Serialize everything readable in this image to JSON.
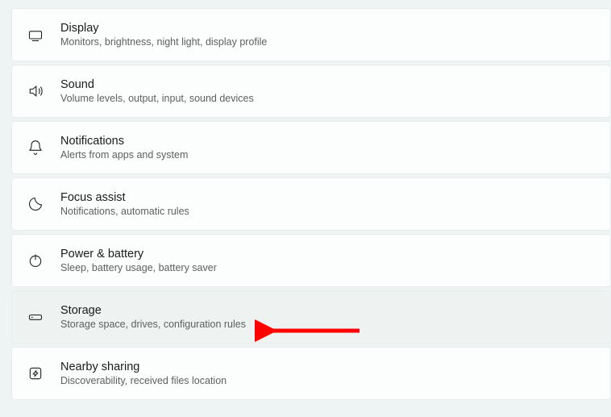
{
  "settings": {
    "items": [
      {
        "title": "Display",
        "desc": "Monitors, brightness, night light, display profile"
      },
      {
        "title": "Sound",
        "desc": "Volume levels, output, input, sound devices"
      },
      {
        "title": "Notifications",
        "desc": "Alerts from apps and system"
      },
      {
        "title": "Focus assist",
        "desc": "Notifications, automatic rules"
      },
      {
        "title": "Power & battery",
        "desc": "Sleep, battery usage, battery saver"
      },
      {
        "title": "Storage",
        "desc": "Storage space, drives, configuration rules"
      },
      {
        "title": "Nearby sharing",
        "desc": "Discoverability, received files location"
      }
    ]
  },
  "annotation": {
    "arrow_color": "#ff0000"
  }
}
